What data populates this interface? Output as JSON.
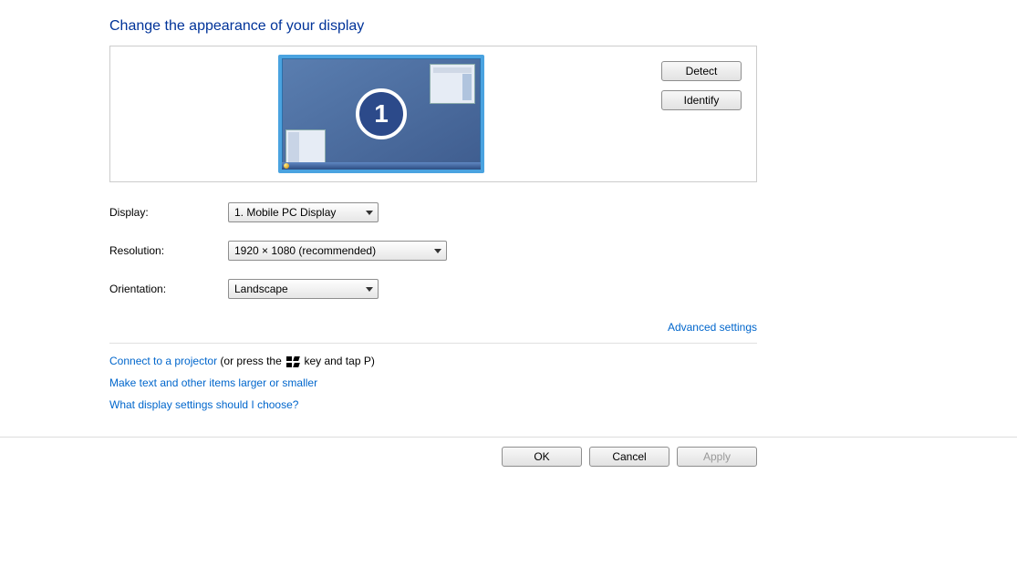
{
  "heading": "Change the appearance of your display",
  "monitor_number": "1",
  "buttons": {
    "detect": "Detect",
    "identify": "Identify",
    "ok": "OK",
    "cancel": "Cancel",
    "apply": "Apply"
  },
  "labels": {
    "display": "Display:",
    "resolution": "Resolution:",
    "orientation": "Orientation:"
  },
  "selects": {
    "display": "1. Mobile PC Display",
    "resolution": "1920 × 1080 (recommended)",
    "orientation": "Landscape"
  },
  "links": {
    "advanced": "Advanced settings",
    "projector": "Connect to a projector",
    "projector_suffix_a": " (or press the ",
    "projector_suffix_b": " key and tap P)",
    "textsize": "Make text and other items larger or smaller",
    "help": "What display settings should I choose?"
  }
}
